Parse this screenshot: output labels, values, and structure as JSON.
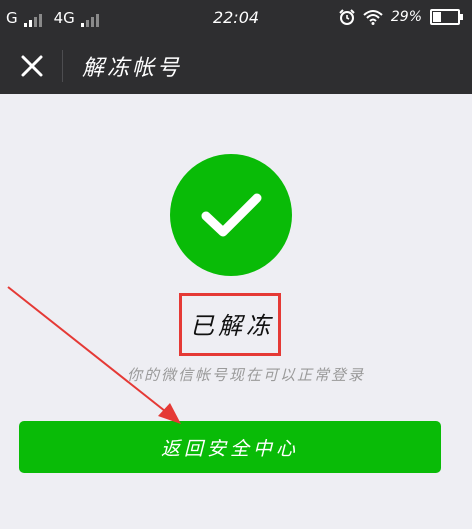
{
  "status_bar": {
    "carrier1": "G",
    "carrier2": "4G",
    "time": "22:04",
    "battery": "29%",
    "battery_level": 0.29,
    "icons": [
      "signal-icon",
      "signal-icon",
      "alarm-icon",
      "wifi-icon",
      "battery-icon"
    ]
  },
  "nav": {
    "title": "解冻帐号",
    "close_icon": "close-icon"
  },
  "main": {
    "success_icon": "checkmark-icon",
    "status": "已解冻",
    "description": "你的微信帐号现在可以正常登录",
    "button_label": "返回安全中心"
  },
  "colors": {
    "accent_green": "#09bb07",
    "bar_dark": "#2e2e30",
    "background": "#eeeef3",
    "annotation_red": "#e53935"
  }
}
